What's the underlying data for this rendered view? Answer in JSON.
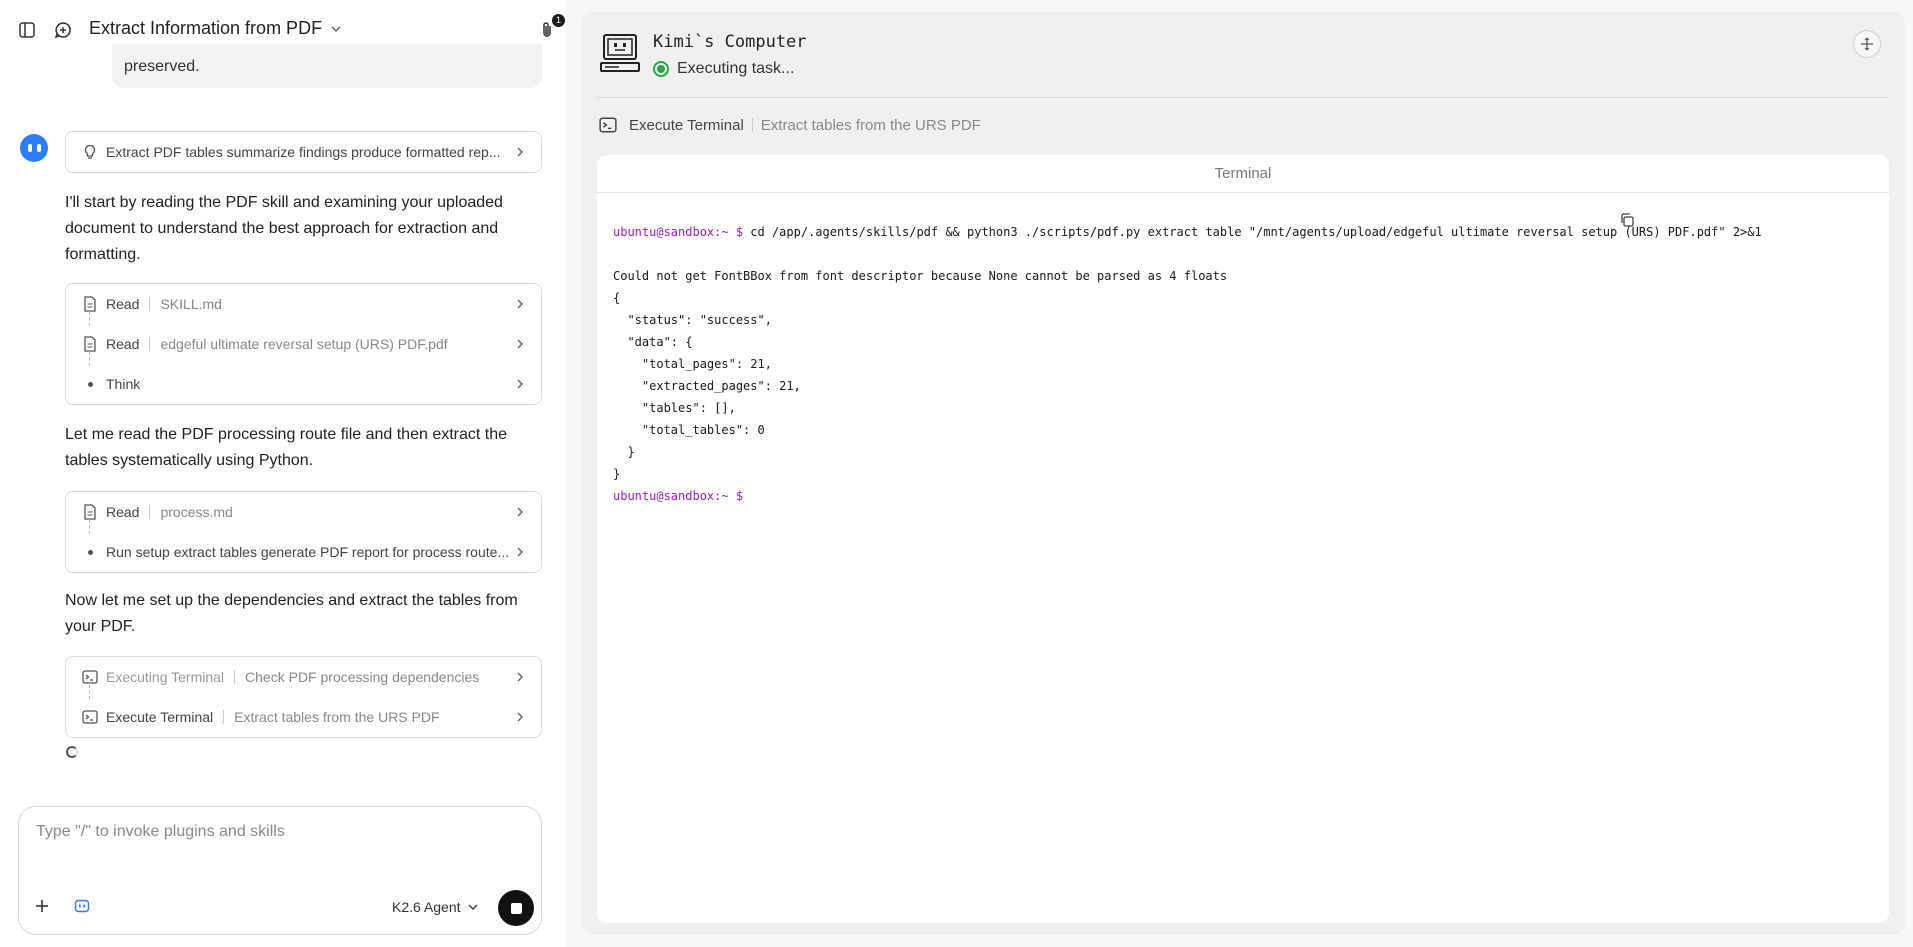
{
  "header": {
    "title": "Extract Information from PDF",
    "attachment_count": "1"
  },
  "chat": {
    "user_tail": "preserved.",
    "task_card": "Extract PDF tables summarize findings produce formatted rep...",
    "para1": "I'll start by reading the PDF skill and examining your uploaded document to understand the best approach for extraction and formatting.",
    "steps1": [
      {
        "label": "Read",
        "sub": "SKILL.md",
        "icon": "file-icon"
      },
      {
        "label": "Read",
        "sub": "edgeful ultimate reversal setup (URS) PDF.pdf",
        "icon": "file-icon"
      },
      {
        "label": "Think",
        "sub": "",
        "icon": "dot-icon"
      }
    ],
    "para2": "Let me read the PDF processing route file and then extract the tables systematically using Python.",
    "steps2": [
      {
        "label": "Read",
        "sub": "process.md",
        "icon": "file-icon"
      },
      {
        "label": "Run setup extract tables generate PDF report for process route...",
        "sub": "",
        "icon": "dot-icon"
      }
    ],
    "para3": "Now let me set up the dependencies and extract the tables from your PDF.",
    "steps3": [
      {
        "label": "Executing Terminal",
        "sub": "Check PDF processing dependencies",
        "icon": "terminal-icon"
      },
      {
        "label": "Execute Terminal",
        "sub": "Extract tables from the URS PDF",
        "icon": "terminal-icon"
      }
    ]
  },
  "input": {
    "placeholder": "Type \"/\" to invoke plugins and skills",
    "model": "K2.6 Agent"
  },
  "computer": {
    "title": "Kimi`s Computer",
    "status": "Executing task...",
    "crumb_label": "Execute Terminal",
    "crumb_sub": "Extract tables from the URS PDF",
    "terminal_title": "Terminal",
    "prompt": "ubuntu@sandbox:~ $",
    "command": " cd /app/.agents/skills/pdf && python3 ./scripts/pdf.py extract table \"/mnt/agents/upload/edgeful ultimate reversal setup (URS) PDF.pdf\" 2>&1",
    "output": "Could not get FontBBox from font descriptor because None cannot be parsed as 4 floats\n{\n  \"status\": \"success\",\n  \"data\": {\n    \"total_pages\": 21,\n    \"extracted_pages\": 21,\n    \"tables\": [],\n    \"total_tables\": 0\n  }\n}",
    "final_prompt": "ubuntu@sandbox:~ $"
  },
  "colors": {
    "accent_blue": "#2f7df6",
    "status_green": "#27a844",
    "prompt_purple": "#a020c0"
  }
}
